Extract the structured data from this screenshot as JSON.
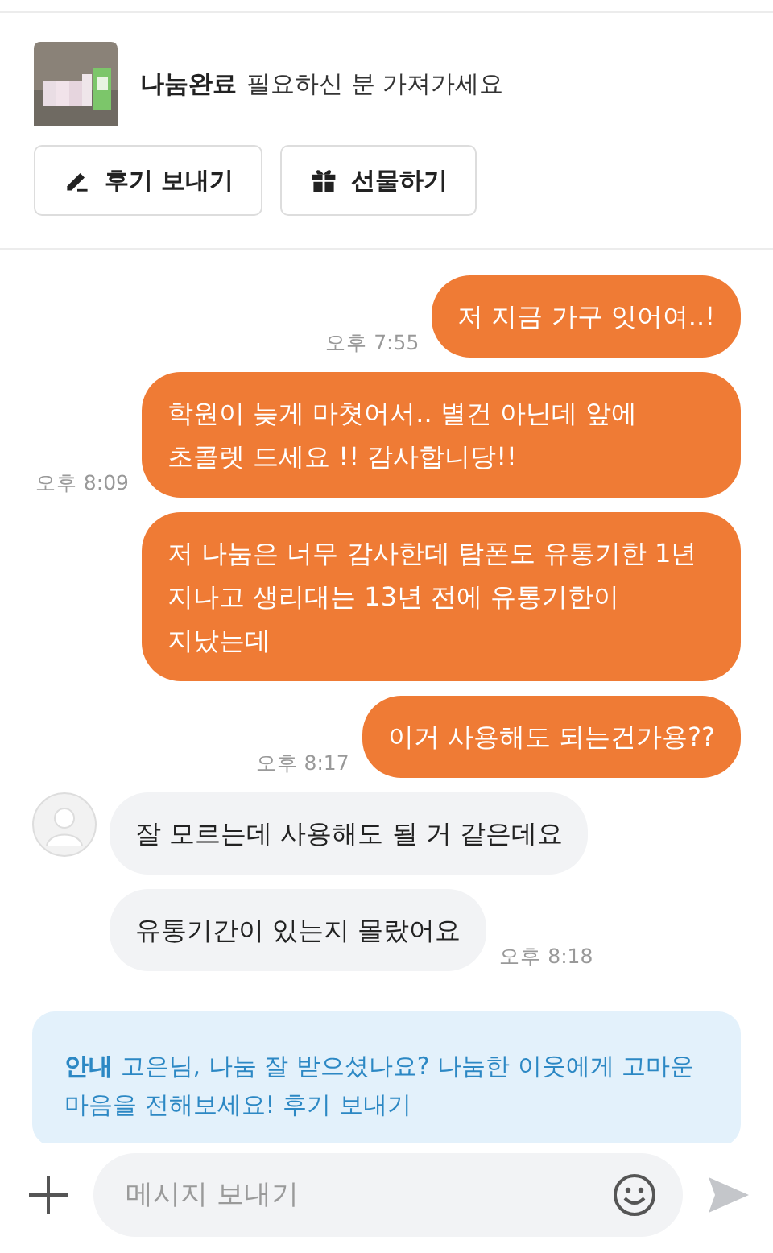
{
  "product": {
    "status": "나눔완료",
    "title": "필요하신 분 가져가세요"
  },
  "actions": [
    {
      "kind": "review",
      "label": "후기 보내기"
    },
    {
      "kind": "gift",
      "label": "선물하기"
    }
  ],
  "messages": [
    {
      "kind": "outgoing",
      "text": "저 지금 가구 잇어여..!",
      "time": "오후 7:55"
    },
    {
      "kind": "outgoing",
      "text": "학원이 늦게 마쳣어서.. 별건 아닌데 앞에 초콜렛 드세요 !! 감사합니당!!",
      "time": "오후 8:09"
    },
    {
      "kind": "outgoing",
      "text": "저 나눔은 너무 감사한데 탐폰도 유통기한 1년 지나고 생리대는 13년 전에 유통기한이 지났는데"
    },
    {
      "kind": "outgoing",
      "text": "이거 사용해도 되는건가용??",
      "time": "오후 8:17"
    },
    {
      "kind": "incoming",
      "avatar": true,
      "text": "잘 모르는데 사용해도 될 거 같은데요"
    },
    {
      "kind": "incoming",
      "avatar": false,
      "text": "유통기간이 있는지 몰랐어요",
      "time": "오후 8:18"
    }
  ],
  "notice": {
    "label": "안내",
    "text": "고은님, 나눔 잘 받으셨나요? 나눔한 이웃에게 고마운 마음을 전해보세요!",
    "link": "후기 보내기"
  },
  "composer": {
    "placeholder": "메시지 보내기"
  }
}
